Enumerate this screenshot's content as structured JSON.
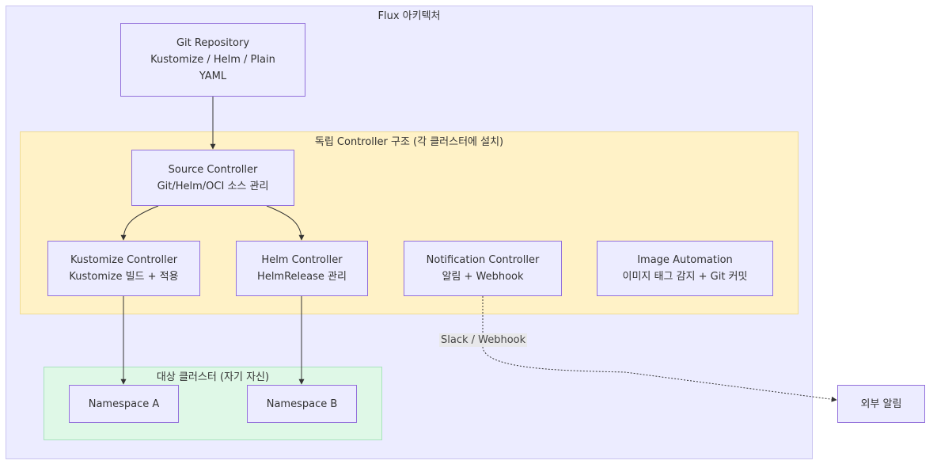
{
  "clusters": {
    "flux": "Flux 아키텍처",
    "controllers": "독립 Controller 구조 (각 클러스터에 설치)",
    "target": "대상 클러스터 (자기 자신)"
  },
  "nodes": {
    "git_repo": [
      "Git Repository",
      "Kustomize / Helm / Plain",
      "YAML"
    ],
    "source_controller": [
      "Source Controller",
      "Git/Helm/OCI 소스 관리"
    ],
    "kustomize_controller": [
      "Kustomize Controller",
      "Kustomize 빌드 + 적용"
    ],
    "helm_controller": [
      "Helm Controller",
      "HelmRelease 관리"
    ],
    "notification_controller": [
      "Notification Controller",
      "알림 + Webhook"
    ],
    "image_automation": [
      "Image Automation",
      "이미지 태그 감지 + Git 커밋"
    ],
    "namespace_a": [
      "Namespace A"
    ],
    "namespace_b": [
      "Namespace B"
    ],
    "external_alert": [
      "외부 알림"
    ]
  },
  "edges": {
    "notification_to_external": "Slack / Webhook"
  },
  "colors": {
    "node_fill": "#ececff",
    "node_border": "#9370db",
    "flux_cluster": "#ececff",
    "controller_cluster": "#fff2c7",
    "target_cluster": "#dff8e7",
    "edge": "#333333"
  }
}
